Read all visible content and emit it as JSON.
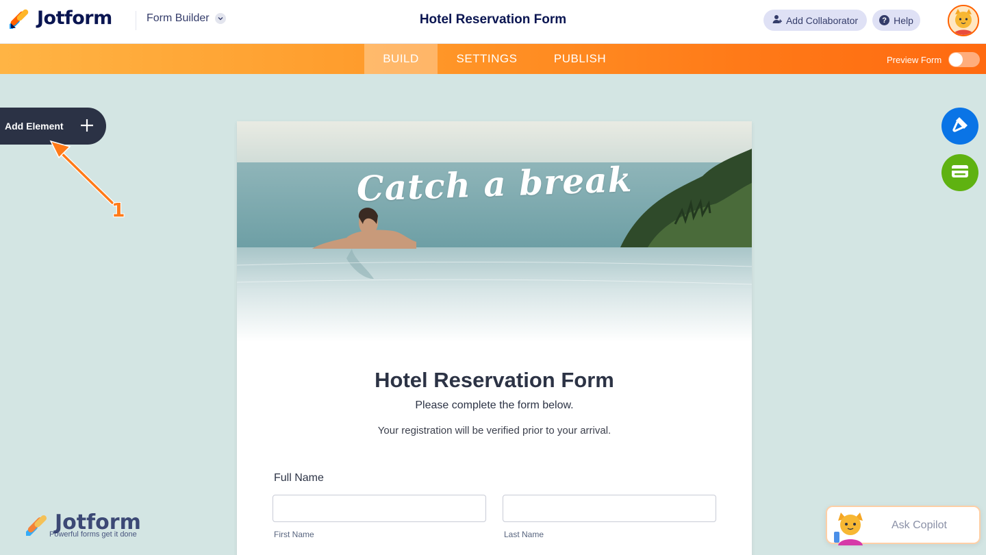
{
  "app": {
    "brand": "Jotform",
    "mode_switch": "Form Builder",
    "form_title": "Hotel Reservation Form",
    "add_collaborator": "Add Collaborator",
    "help": "Help"
  },
  "nav": {
    "tabs": [
      {
        "label": "BUILD",
        "active": true
      },
      {
        "label": "SETTINGS",
        "active": false
      },
      {
        "label": "PUBLISH",
        "active": false
      }
    ],
    "preview_label": "Preview Form",
    "preview_on": false
  },
  "sidebar": {
    "add_element": "Add Element"
  },
  "annotation": {
    "number": "1"
  },
  "form": {
    "hero_tagline": "Catch a break",
    "heading": "Hotel Reservation Form",
    "subheading": "Please complete the form below.",
    "note": "Your registration will be verified prior to your arrival.",
    "full_name": {
      "label": "Full Name",
      "first_value": "",
      "last_value": "",
      "first_sublabel": "First Name",
      "last_sublabel": "Last Name"
    }
  },
  "watermark": {
    "brand": "Jotform",
    "tagline": "Powerful forms get it done"
  },
  "copilot": {
    "label": "Ask Copilot"
  },
  "colors": {
    "brand_navy": "#0a1551",
    "nav_orange": "#ff7a18",
    "design_button": "#0a74e6",
    "payment_button": "#5fb211",
    "add_element_bg": "#2b3245"
  },
  "icons": [
    "jotform-logo-icon",
    "chevron-down-icon",
    "add-user-icon",
    "help-icon",
    "avatar-icon",
    "plus-icon",
    "paint-roller-icon",
    "card-icon",
    "copilot-cat-icon"
  ]
}
